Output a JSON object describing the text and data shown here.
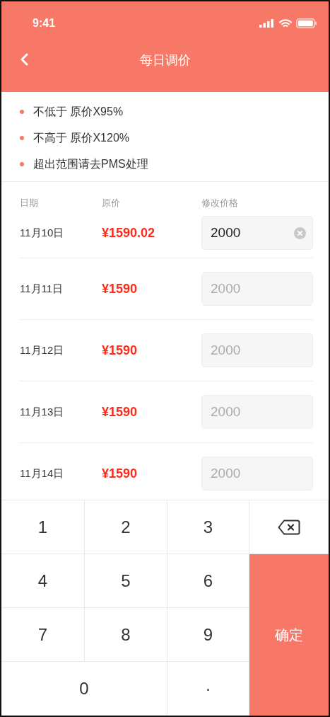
{
  "status_bar": {
    "time": "9:41"
  },
  "nav": {
    "title": "每日调价"
  },
  "rules": [
    "不低于 原价X95%",
    "不高于 原价X120%",
    "超出范围请去PMS处理"
  ],
  "table": {
    "columns": [
      "日期",
      "原价",
      "修改价格"
    ],
    "rows": [
      {
        "date": "11月10日",
        "price": "¥1590.02",
        "input": {
          "value": "2000"
        }
      },
      {
        "date": "11月11日",
        "price": "¥1590",
        "input": {
          "placeholder": "2000"
        }
      },
      {
        "date": "11月12日",
        "price": "¥1590",
        "input": {
          "placeholder": "2000"
        }
      },
      {
        "date": "11月13日",
        "price": "¥1590",
        "input": {
          "placeholder": "2000"
        }
      },
      {
        "date": "11月14日",
        "price": "¥1590",
        "input": {
          "placeholder": "2000"
        }
      }
    ]
  },
  "keypad": [
    {
      "kind": "digit",
      "label": "1"
    },
    {
      "kind": "digit",
      "label": "2"
    },
    {
      "kind": "digit",
      "label": "3"
    },
    {
      "kind": "backspace"
    },
    {
      "kind": "digit",
      "label": "4"
    },
    {
      "kind": "digit",
      "label": "5"
    },
    {
      "kind": "digit",
      "label": "6"
    },
    {
      "kind": "digit",
      "label": "7"
    },
    {
      "kind": "digit",
      "label": "8"
    },
    {
      "kind": "digit",
      "label": "9"
    },
    {
      "kind": "confirm",
      "label": "确定"
    },
    {
      "kind": "wide",
      "label": "0"
    },
    {
      "kind": "digit",
      "label": "·"
    }
  ]
}
